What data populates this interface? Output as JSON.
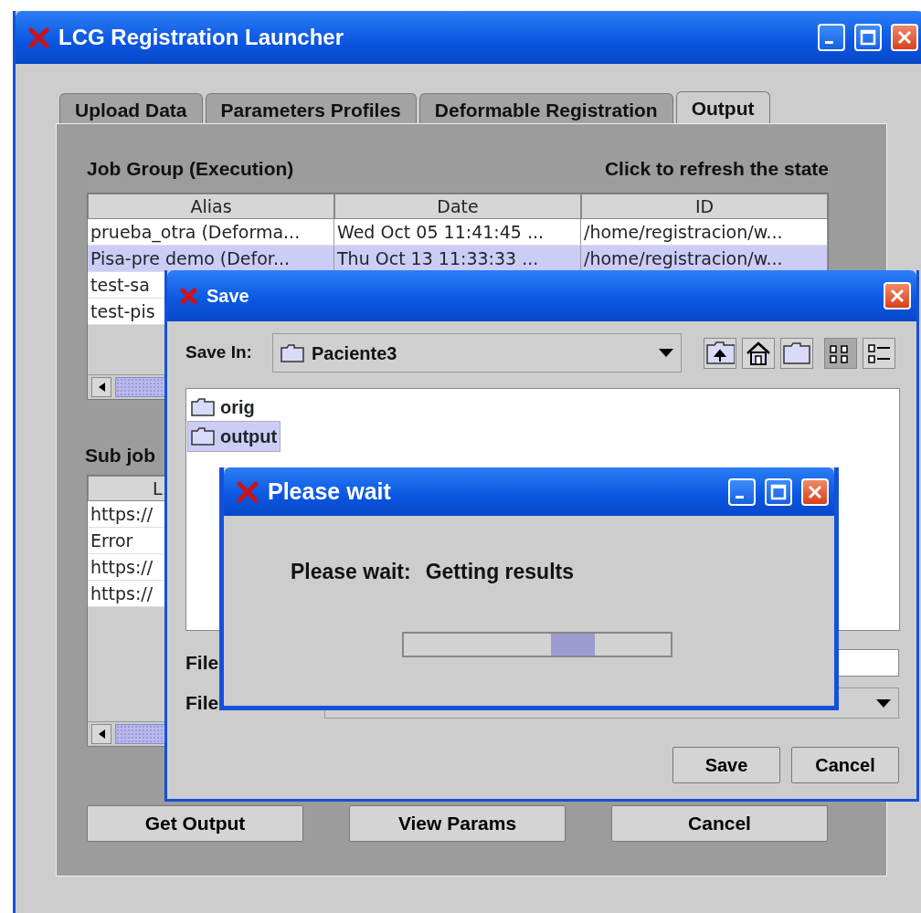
{
  "main_window": {
    "title": "LCG Registration Launcher",
    "tabs": [
      {
        "label": "Upload Data",
        "selected": false
      },
      {
        "label": "Parameters Profiles",
        "selected": false
      },
      {
        "label": "Deformable Registration",
        "selected": false
      },
      {
        "label": "Output",
        "selected": true
      }
    ],
    "job_group": {
      "label": "Job Group (Execution)",
      "refresh_hint": "Click to refresh the state",
      "columns": [
        "Alias",
        "Date",
        "ID"
      ],
      "rows": [
        {
          "cells": [
            "prueba_otra (Deforma...",
            "Wed Oct 05 11:41:45 ...",
            "/home/registracion/w..."
          ],
          "selected": false
        },
        {
          "cells": [
            "Pisa-pre demo (Defor...",
            "Thu Oct 13 11:33:33 ...",
            "/home/registracion/w..."
          ],
          "selected": true
        },
        {
          "cells": [
            "test-sa"
          ],
          "selected": false
        },
        {
          "cells": [
            "test-pis"
          ],
          "selected": false
        }
      ]
    },
    "sub_jobs": {
      "label": "Sub job",
      "columns": [
        "L"
      ],
      "rows": [
        {
          "cells": [
            "https://"
          ],
          "selected": false
        },
        {
          "cells": [
            "Error"
          ],
          "selected": false
        },
        {
          "cells": [
            "https://"
          ],
          "selected": false
        },
        {
          "cells": [
            "https://"
          ],
          "selected": false
        }
      ]
    },
    "buttons": [
      "Get Output",
      "View Params",
      "Cancel"
    ]
  },
  "save_dialog": {
    "title": "Save",
    "save_in_label": "Save In:",
    "folder": "Paciente3",
    "toolbar": [
      {
        "kind": "up-folder",
        "selected": false
      },
      {
        "kind": "home",
        "selected": false
      },
      {
        "kind": "new-folder",
        "selected": false
      },
      {
        "kind": "grid-view",
        "selected": true
      },
      {
        "kind": "list-view",
        "selected": false
      }
    ],
    "files": [
      {
        "name": "orig",
        "selected": false
      },
      {
        "name": "output",
        "selected": true
      }
    ],
    "file_name_label": "File",
    "file_type_label": "File",
    "buttons": [
      "Save",
      "Cancel"
    ]
  },
  "wait_dialog": {
    "title": "Please wait",
    "label": "Please wait:",
    "message": "Getting results",
    "progress": {
      "indeterminate": true
    }
  }
}
